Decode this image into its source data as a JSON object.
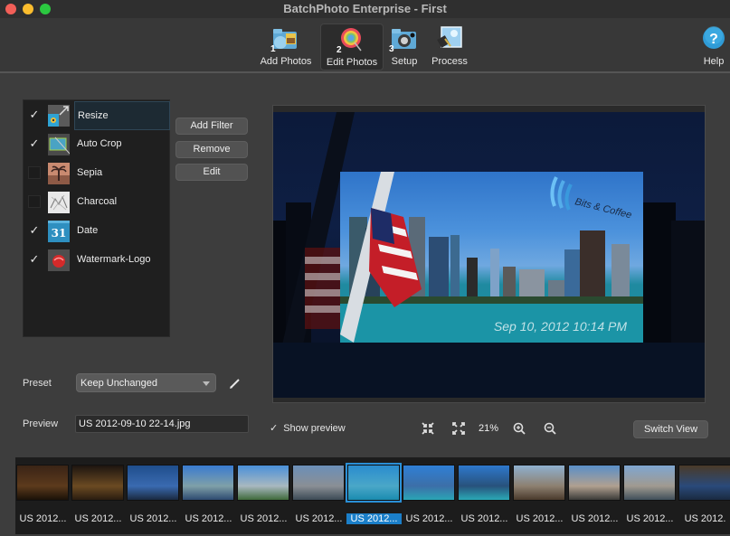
{
  "window": {
    "title": "BatchPhoto Enterprise - First"
  },
  "toolbar": {
    "items": [
      {
        "label": "Add Photos",
        "step": "1",
        "icon": "add-photos-icon"
      },
      {
        "label": "Edit Photos",
        "step": "2",
        "icon": "edit-photos-icon",
        "active": true
      },
      {
        "label": "Setup",
        "step": "3",
        "icon": "setup-icon"
      },
      {
        "label": "Process",
        "step": "",
        "icon": "process-icon"
      }
    ],
    "help_label": "Help"
  },
  "filters": {
    "items": [
      {
        "label": "Resize",
        "checked": true,
        "selected": true,
        "icon": "resize-icon"
      },
      {
        "label": "Auto Crop",
        "checked": true,
        "icon": "auto-crop-icon"
      },
      {
        "label": "Sepia",
        "checked": false,
        "icon": "sepia-icon"
      },
      {
        "label": "Charcoal",
        "checked": false,
        "icon": "charcoal-icon"
      },
      {
        "label": "Date",
        "checked": true,
        "icon": "date-icon",
        "icon_text": "31"
      },
      {
        "label": "Watermark-Logo",
        "checked": true,
        "icon": "watermark-logo-icon"
      }
    ],
    "check_glyph": "✓"
  },
  "actions": {
    "add_filter": "Add Filter",
    "remove": "Remove",
    "edit": "Edit"
  },
  "preset": {
    "label": "Preset",
    "value": "Keep Unchanged"
  },
  "preview": {
    "label": "Preview",
    "value": "US 2012-09-10 22-14.jpg",
    "stamp_text": "Sep 10, 2012 10:14 PM",
    "watermark_text": "Bits & Coffee"
  },
  "preview_controls": {
    "show_preview_label": "Show preview",
    "show_preview_checked": true,
    "zoom_percent": "21%",
    "switch_view_label": "Switch View"
  },
  "filmstrip": {
    "selected_index": 6,
    "items": [
      {
        "label": "US 2012...",
        "colors": [
          "#3a2416",
          "#5c3a1c",
          "#1a1108"
        ]
      },
      {
        "label": "US 2012...",
        "colors": [
          "#1d1510",
          "#6b4a22",
          "#2a1c10"
        ]
      },
      {
        "label": "US 2012...",
        "colors": [
          "#1f4e8c",
          "#3a6ab0",
          "#1a2a40"
        ]
      },
      {
        "label": "US 2012...",
        "colors": [
          "#3a7bd0",
          "#7fa0a8",
          "#2d4a70"
        ]
      },
      {
        "label": "US 2012...",
        "colors": [
          "#4a90d9",
          "#a8b8c0",
          "#3f6a3a"
        ]
      },
      {
        "label": "US 2012...",
        "colors": [
          "#6b8fb8",
          "#8a8f95",
          "#3c4a55"
        ]
      },
      {
        "label": "US 2012...",
        "colors": [
          "#2a8ccf",
          "#4aa7c8",
          "#1a8bb0"
        ]
      },
      {
        "label": "US 2012...",
        "colors": [
          "#2f7fd5",
          "#3c6fa8",
          "#2aa5b5"
        ]
      },
      {
        "label": "US 2012...",
        "colors": [
          "#2e78cc",
          "#28527c",
          "#2aa9b6"
        ]
      },
      {
        "label": "US 2012...",
        "colors": [
          "#8fb0cf",
          "#8d8070",
          "#4a3a2c"
        ]
      },
      {
        "label": "US 2012...",
        "colors": [
          "#5a8fc8",
          "#b0a090",
          "#3a3a38"
        ]
      },
      {
        "label": "US 2012...",
        "colors": [
          "#7fa6d0",
          "#a09a90",
          "#3f4f5a"
        ]
      },
      {
        "label": "US 2012.",
        "colors": [
          "#4a3a28",
          "#2a4a7a",
          "#1a2a40"
        ]
      }
    ]
  }
}
